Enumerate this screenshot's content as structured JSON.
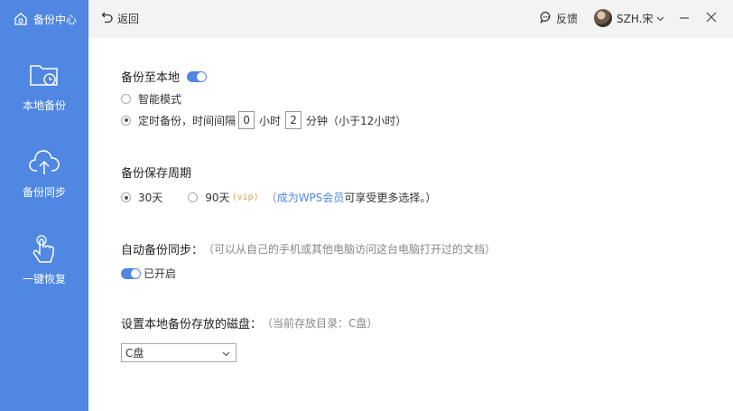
{
  "sidebar": {
    "header_title": "备份中心",
    "items": [
      {
        "label": "本地备份"
      },
      {
        "label": "备份同步"
      },
      {
        "label": "一键恢复"
      }
    ]
  },
  "topbar": {
    "back_label": "返回",
    "feedback_label": "反馈",
    "user_name": "SZH.宋"
  },
  "local_backup": {
    "title": "备份至本地",
    "enabled": true,
    "mode_smart_label": "智能模式",
    "mode_timed_label": "定时备份，时间间隔",
    "hours_value": "0",
    "hours_unit": "小时",
    "minutes_value": "2",
    "minutes_unit": "分钟（小于12小时）",
    "selected_mode": "timed"
  },
  "retention": {
    "title": "备份保存周期",
    "opt30_label": "30天",
    "opt90_label": "90天",
    "vip_tag": "(vip)",
    "hint_open": "（",
    "link_text": "成为WPS会员",
    "hint_rest": " 可享受更多选择。）",
    "selected": "30天"
  },
  "auto_sync": {
    "title": "自动备份同步：",
    "hint": "（可以从自己的手机或其他电脑访问这台电脑打开过的文档）",
    "status_label": "已开启",
    "enabled": true
  },
  "disk": {
    "title": "设置本地备份存放的磁盘：",
    "hint": "（当前存放目录：C盘）",
    "selected": "C盘"
  },
  "colors": {
    "accent": "#4f87e3",
    "topbar_bg": "#f3f3f3"
  }
}
